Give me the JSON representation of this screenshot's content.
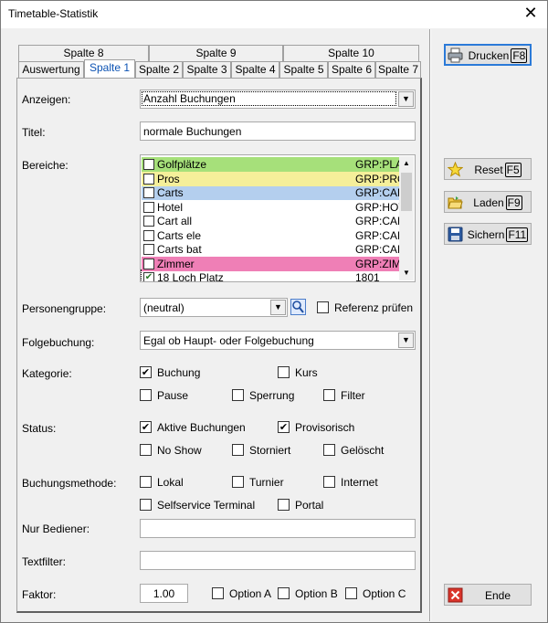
{
  "window": {
    "title": "Timetable-Statistik"
  },
  "tabs_row1": [
    "Spalte 8",
    "Spalte 9",
    "Spalte 10"
  ],
  "tabs_row2": [
    "Auswertung",
    "Spalte 1",
    "Spalte 2",
    "Spalte 3",
    "Spalte 4",
    "Spalte 5",
    "Spalte 6",
    "Spalte 7"
  ],
  "active_tab": "Spalte 1",
  "form": {
    "anzeigen_label": "Anzeigen:",
    "anzeigen_value": "Anzahl Buchungen",
    "titel_label": "Titel:",
    "titel_value": "normale Buchungen",
    "bereiche_label": "Bereiche:",
    "bereiche_items": [
      {
        "name": "Golfplätze",
        "code": "GRP:PLA",
        "checked": false,
        "color": "#a6e07a"
      },
      {
        "name": "Pros",
        "code": "GRP:PRO",
        "checked": false,
        "color": "#f5ef9a"
      },
      {
        "name": "Carts",
        "code": "GRP:CAR",
        "checked": false,
        "color": "#b4cfee"
      },
      {
        "name": "Hotel",
        "code": "GRP:HOT",
        "checked": false,
        "color": "#ffffff"
      },
      {
        "name": "Cart all",
        "code": "GRP:CAR",
        "checked": false,
        "color": "#ffffff"
      },
      {
        "name": "Carts ele",
        "code": "GRP:CAR",
        "checked": false,
        "color": "#ffffff"
      },
      {
        "name": "Carts bat",
        "code": "GRP:CAR",
        "checked": false,
        "color": "#ffffff"
      },
      {
        "name": "Zimmer",
        "code": "GRP:ZIM",
        "checked": false,
        "color": "#ef7fb6"
      },
      {
        "name": "18 Loch Platz",
        "code": "1801",
        "checked": true,
        "color": "#ffffff"
      }
    ],
    "personengruppe_label": "Personengruppe:",
    "personengruppe_value": "(neutral)",
    "referenz_label": "Referenz prüfen",
    "referenz_checked": false,
    "folgebuchung_label": "Folgebuchung:",
    "folgebuchung_value": "Egal ob Haupt- oder Folgebuchung",
    "kategorie_label": "Kategorie:",
    "kategorie": [
      {
        "label": "Buchung",
        "checked": true
      },
      {
        "label": "Kurs",
        "checked": false
      },
      {
        "label": "Pause",
        "checked": false
      },
      {
        "label": "Sperrung",
        "checked": false
      },
      {
        "label": "Filter",
        "checked": false
      }
    ],
    "status_label": "Status:",
    "status": [
      {
        "label": "Aktive Buchungen",
        "checked": true
      },
      {
        "label": "Provisorisch",
        "checked": true
      },
      {
        "label": "No Show",
        "checked": false
      },
      {
        "label": "Storniert",
        "checked": false
      },
      {
        "label": "Gelöscht",
        "checked": false
      }
    ],
    "buchungsmethode_label": "Buchungsmethode:",
    "buchungsmethode": [
      {
        "label": "Lokal",
        "checked": false
      },
      {
        "label": "Turnier",
        "checked": false
      },
      {
        "label": "Internet",
        "checked": false
      },
      {
        "label": "Selfservice Terminal",
        "checked": false
      },
      {
        "label": "Portal",
        "checked": false
      }
    ],
    "nur_bediener_label": "Nur Bediener:",
    "nur_bediener_value": "",
    "textfilter_label": "Textfilter:",
    "textfilter_value": "",
    "faktor_label": "Faktor:",
    "faktor_value": "1.00",
    "options": [
      {
        "label": "Option A",
        "checked": false
      },
      {
        "label": "Option B",
        "checked": false
      },
      {
        "label": "Option C",
        "checked": false
      }
    ]
  },
  "buttons": {
    "drucken": {
      "label": "Drucken",
      "key": "F8",
      "icon": "printer-icon"
    },
    "reset": {
      "label": "Reset",
      "key": "F5",
      "icon": "star-icon"
    },
    "laden": {
      "label": "Laden",
      "key": "F9",
      "icon": "open-folder-icon"
    },
    "sichern": {
      "label": "Sichern",
      "key": "F11",
      "icon": "save-icon"
    },
    "ende": {
      "label": "Ende",
      "key": "",
      "icon": "exit-icon"
    }
  }
}
